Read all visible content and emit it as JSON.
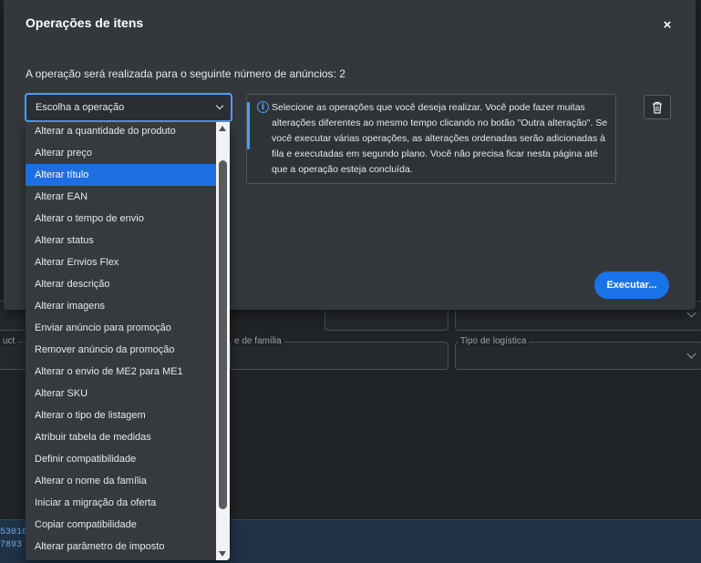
{
  "modal": {
    "title": "Operações de itens",
    "close_symbol": "×",
    "subtitle": "A operação será realizada para o seguinte número de anúncios: 2",
    "execute_label": "Executar..."
  },
  "select": {
    "value": "Escolha a operação"
  },
  "info": {
    "icon_symbol": "i",
    "text": "Selecione as operações que você deseja realizar. Você pode fazer muitas alterações diferentes ao mesmo tempo clicando no botão \"Outra alteração\". Se você executar várias operações, as alterações ordenadas serão adicionadas à fila e executadas em segundo plano. Você não precisa ficar nesta página até que a operação esteja concluída."
  },
  "dropdown": {
    "selected_index": 2,
    "options": [
      "Alterar a quantidade do produto",
      "Alterar preço",
      "Alterar título",
      "Alterar EAN",
      "Alterar o tempo de envio",
      "Alterar status",
      "Alterar Envios Flex",
      "Alterar descrição",
      "Alterar imagens",
      "Enviar anúncio para promoção",
      "Remover anúncio da promoção",
      "Alterar o envio de ME2 para ME1",
      "Alterar SKU",
      "Alterar o tipo de listagem",
      "Atribuir tabela de medidas",
      "Definir compatibilidade",
      "Alterar o nome da família",
      "Iniciar a migração da oferta",
      "Copiar compatibilidade",
      "Alterar parâmetro de imposto"
    ]
  },
  "background": {
    "label_product": "uct",
    "label_family": "e de família",
    "label_logistics": "Tipo de logística",
    "row_line_1": "53010",
    "row_line_2": "7893"
  },
  "colors": {
    "accent": "#4a9eff",
    "primary_button": "#1a73e8",
    "selected_item": "#1d6ee0",
    "modal_bg": "#34383d"
  }
}
